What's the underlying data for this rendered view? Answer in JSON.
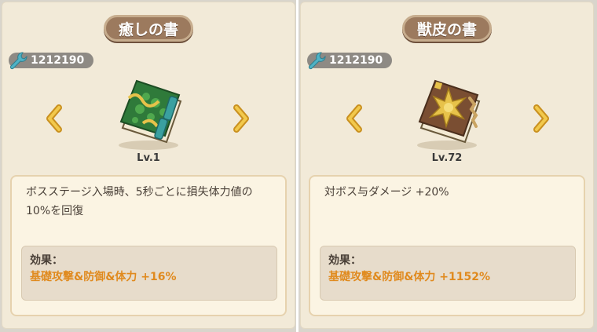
{
  "colors": {
    "panel_bg": "#f2ead8",
    "title_plate": "#9c7a5e",
    "resource_pill": "#8e8a84",
    "arrow": "#e3b23c",
    "effect_value": "#e08a1e"
  },
  "cards": [
    {
      "title": "癒しの書",
      "resource_icon": "wrench-icon",
      "resource_count": "1212190",
      "level": "Lv.1",
      "description": "ボスステージ入場時、5秒ごとに損失体力値の10%を回復",
      "effect_label": "効果：",
      "effect_value": "基礎攻撃&防御&体力 +16%",
      "book_icon": "green-book-icon"
    },
    {
      "title": "獣皮の書",
      "resource_icon": "wrench-icon",
      "resource_count": "1212190",
      "level": "Lv.72",
      "description": "対ボス与ダメージ +20%",
      "effect_label": "効果：",
      "effect_value": "基礎攻撃&防御&体力 +1152%",
      "book_icon": "brown-book-icon"
    }
  ]
}
